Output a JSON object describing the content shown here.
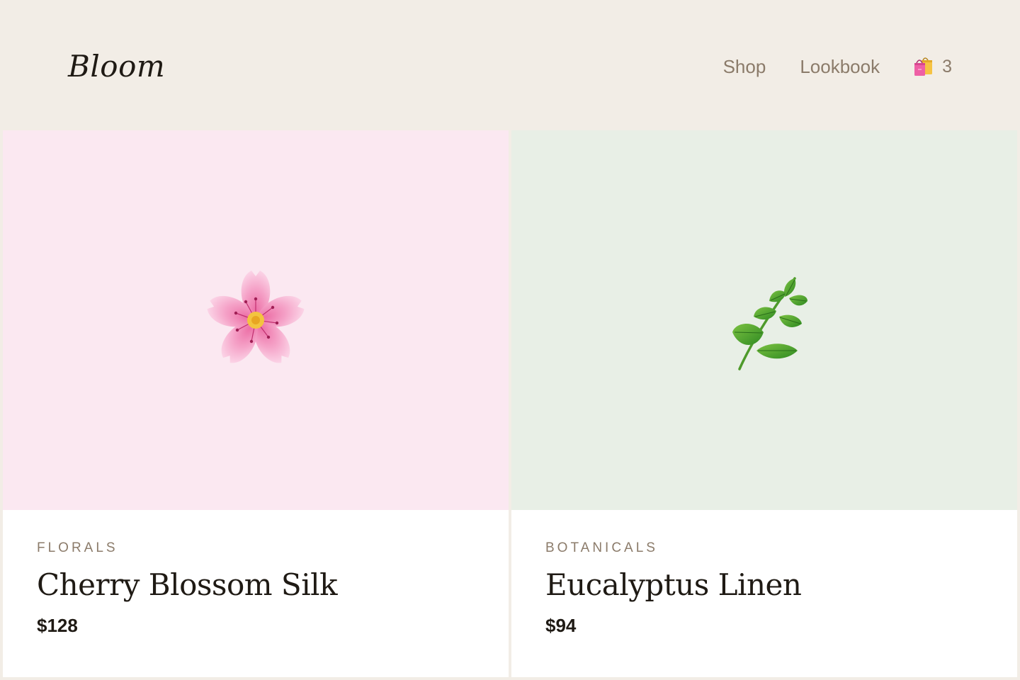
{
  "header": {
    "logo": "Bloom",
    "nav": [
      {
        "label": "Shop"
      },
      {
        "label": "Lookbook"
      }
    ],
    "cart": {
      "icon": "shopping-bags-icon",
      "count": "3"
    }
  },
  "products": [
    {
      "category": "FLORALS",
      "title": "Cherry Blossom Silk",
      "price": "$128",
      "icon": "cherry-blossom-icon",
      "background": "#fbe8f1"
    },
    {
      "category": "BOTANICALS",
      "title": "Eucalyptus Linen",
      "price": "$94",
      "icon": "herb-leaf-icon",
      "background": "#e8efe6"
    }
  ],
  "colors": {
    "page_background": "#f2ede6",
    "muted_text": "#8b7b6a",
    "primary_text": "#1f1a14"
  }
}
